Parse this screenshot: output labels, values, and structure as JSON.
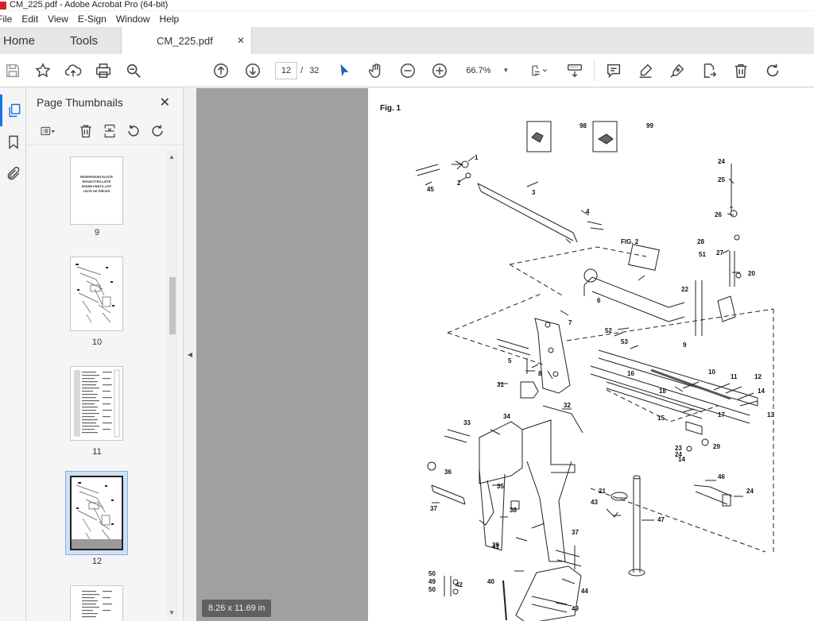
{
  "window": {
    "title": "CM_225.pdf - Adobe Acrobat Pro (64-bit)"
  },
  "menu": [
    "File",
    "Edit",
    "View",
    "E-Sign",
    "Window",
    "Help"
  ],
  "tabs": {
    "home": "Home",
    "tools": "Tools",
    "document": "CM_225.pdf",
    "close": "✕"
  },
  "toolbar": {
    "current_page": "12",
    "page_separator": "/",
    "total_pages": "32",
    "zoom": "66.7%"
  },
  "thumbnails_panel": {
    "title": "Page Thumbnails",
    "close": "✕",
    "pages": [
      {
        "label": "9",
        "text_lines": [
          "RESERVEDELSLISTE",
          "ERSATZTEILLISTE",
          "SPARE PARTS LIST",
          "LISTE DE PIÈCES"
        ]
      },
      {
        "label": "10"
      },
      {
        "label": "11"
      },
      {
        "label": "12",
        "selected": true
      },
      {
        "label": ""
      }
    ]
  },
  "document": {
    "figure_title": "Fig. 1",
    "page_size": "8.26 x 11.69 in",
    "callouts": [
      "1",
      "2",
      "3",
      "4",
      "45",
      "98",
      "99",
      "24",
      "25",
      "26",
      "27",
      "28",
      "51",
      "20",
      "22",
      "FIG. 2",
      "6",
      "7",
      "52",
      "53",
      "9",
      "5",
      "8",
      "10",
      "11",
      "12",
      "13",
      "14",
      "16",
      "18",
      "17",
      "15",
      "23",
      "24",
      "29",
      "31",
      "32",
      "33",
      "34",
      "36",
      "35",
      "38",
      "37",
      "41",
      "37",
      "39",
      "40",
      "44",
      "49",
      "50",
      "49",
      "50",
      "42",
      "21",
      "43",
      "47",
      "46",
      "24",
      "14"
    ]
  }
}
